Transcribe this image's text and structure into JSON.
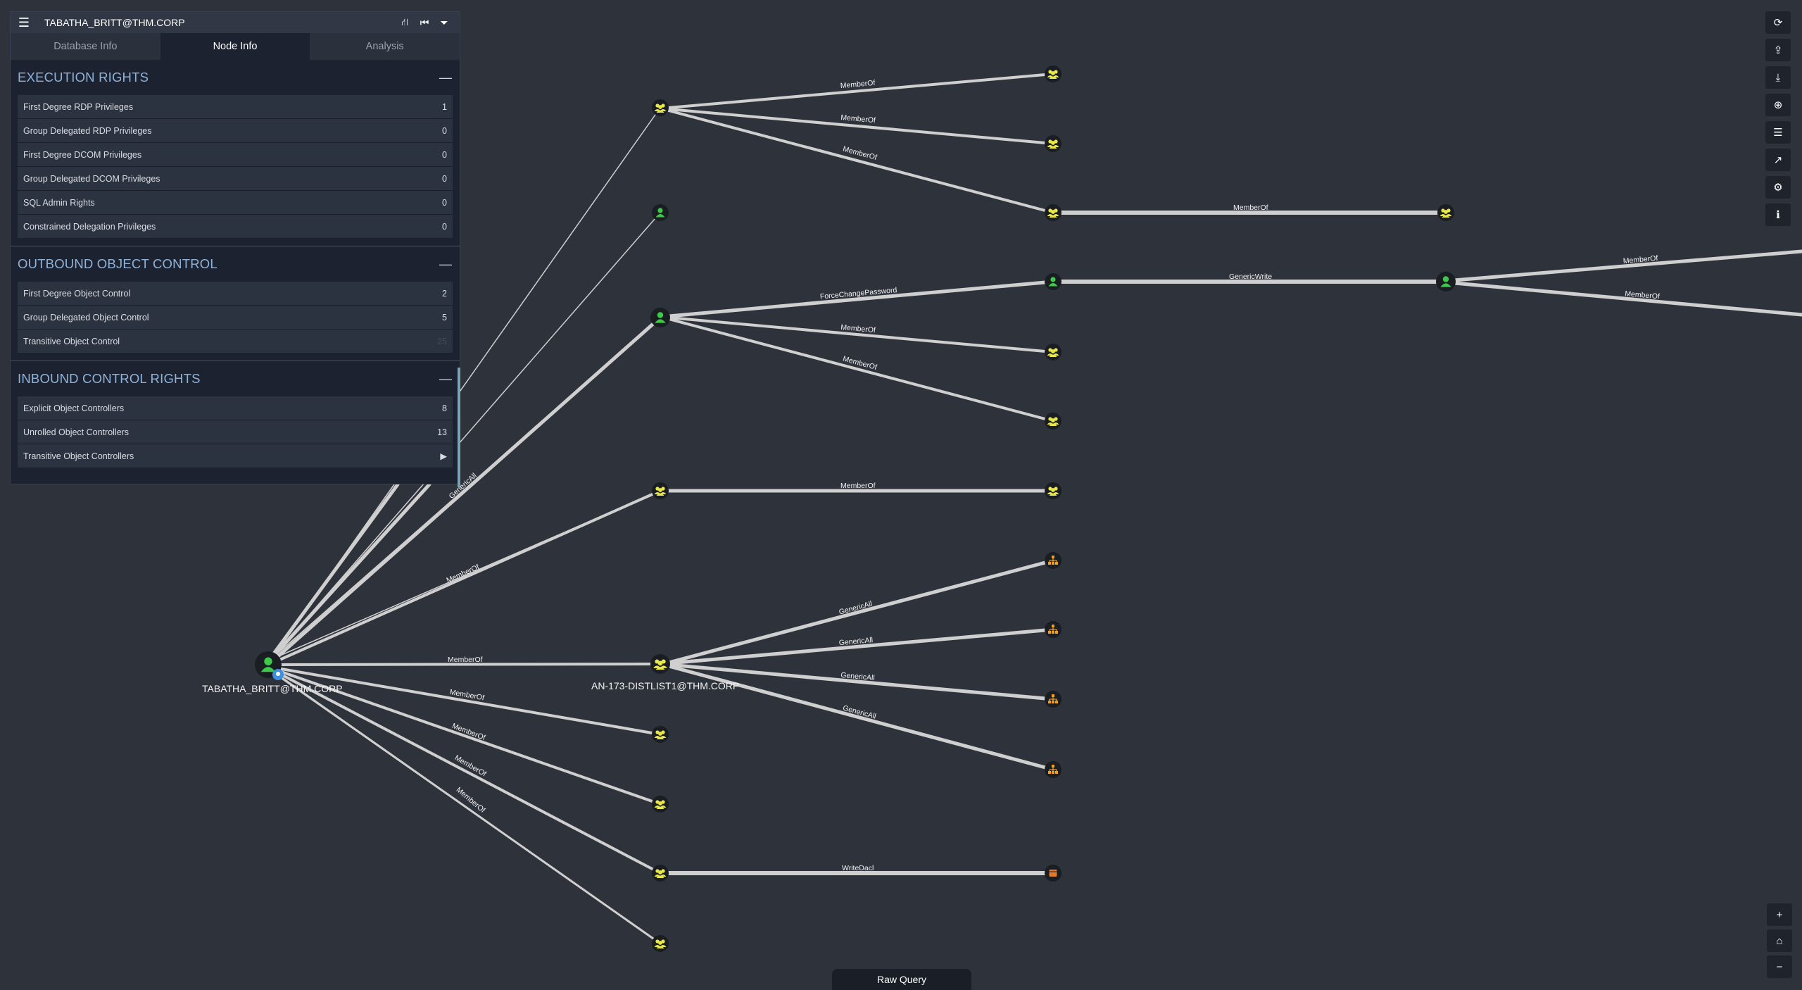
{
  "panel": {
    "node_name": "TABATHA_BRITT@THM.CORP",
    "menu_icon": "hamburger-menu-icon",
    "toolbar": [
      {
        "name": "pathfinding-icon",
        "glyph": "⛙"
      },
      {
        "name": "back-icon",
        "glyph": "⏮"
      },
      {
        "name": "filter-icon",
        "glyph": "⏷"
      }
    ],
    "tabs": [
      {
        "label": "Database Info",
        "active": false
      },
      {
        "label": "Node Info",
        "active": true
      },
      {
        "label": "Analysis",
        "active": false
      }
    ],
    "sections": [
      {
        "title": "EXECUTION RIGHTS",
        "collapse": "—",
        "rows": [
          {
            "label": "First Degree RDP Privileges",
            "value": "1"
          },
          {
            "label": "Group Delegated RDP Privileges",
            "value": "0"
          },
          {
            "label": "First Degree DCOM Privileges",
            "value": "0"
          },
          {
            "label": "Group Delegated DCOM Privileges",
            "value": "0"
          },
          {
            "label": "SQL Admin Rights",
            "value": "0"
          },
          {
            "label": "Constrained Delegation Privileges",
            "value": "0"
          }
        ]
      },
      {
        "title": "OUTBOUND OBJECT CONTROL",
        "collapse": "—",
        "rows": [
          {
            "label": "First Degree Object Control",
            "value": "2"
          },
          {
            "label": "Group Delegated Object Control",
            "value": "5"
          },
          {
            "label": "Transitive Object Control",
            "value": "25"
          }
        ]
      },
      {
        "title": "INBOUND CONTROL RIGHTS",
        "collapse": "—",
        "rows": [
          {
            "label": "Explicit Object Controllers",
            "value": "8"
          },
          {
            "label": "Unrolled Object Controllers",
            "value": "13"
          },
          {
            "label": "Transitive Object Controllers",
            "value": "▶"
          }
        ]
      }
    ]
  },
  "graph": {
    "colors": {
      "edge": "#cfcfcf",
      "node_bg": "#1a1d22",
      "user": "#3ec94a",
      "group": "#e8e84a",
      "ou": "#f0a020",
      "gpo": "#e07a30"
    },
    "labels": {
      "source": "TABATHA_BRITT@THM.CORP",
      "distlist": "AN-173-DISTLIST1@THM.CORP"
    },
    "edge_labels": {
      "memberof": "MemberOf",
      "genericall": "GenericAll",
      "genericwrite": "GenericWrite",
      "forcechange": "ForceChangePassword",
      "writedacl": "WriteDacl"
    }
  },
  "right_toolbar": [
    "refresh-icon",
    "upload-icon",
    "download-icon",
    "import-icon",
    "query-list-icon",
    "chart-icon",
    "settings-icon",
    "info-icon"
  ],
  "zoom_controls": [
    "zoom-in-icon",
    "home-icon",
    "zoom-out-icon"
  ],
  "raw_query": {
    "label": "Raw Query"
  }
}
